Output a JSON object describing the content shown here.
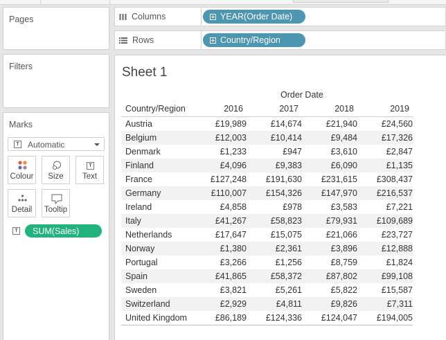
{
  "panels": {
    "pages_title": "Pages",
    "filters_title": "Filters",
    "marks_title": "Marks"
  },
  "shelves": {
    "columns_label": "Columns",
    "columns_pill": "YEAR(Order Date)",
    "rows_label": "Rows",
    "rows_pill": "Country/Region"
  },
  "marks": {
    "mark_type": "Automatic",
    "buttons": {
      "colour": "Colour",
      "size": "Size",
      "text": "Text",
      "detail": "Detail",
      "tooltip": "Tooltip"
    },
    "text_field_pill": "SUM(Sales)",
    "colors": {
      "red": "#e4584f",
      "orange": "#f28e2b",
      "blue": "#4e79a7",
      "purple": "#b07aa1",
      "pill_green": "#20b37d",
      "pill_blue": "#4d96b1"
    }
  },
  "sheet": {
    "title": "Sheet 1",
    "column_group_header": "Order Date",
    "row_header": "Country/Region",
    "years": [
      "2016",
      "2017",
      "2018",
      "2019"
    ],
    "rows": [
      {
        "country": "Austria",
        "values": [
          "£19,989",
          "£14,674",
          "£21,940",
          "£24,560"
        ]
      },
      {
        "country": "Belgium",
        "values": [
          "£12,003",
          "£10,414",
          "£9,484",
          "£17,326"
        ]
      },
      {
        "country": "Denmark",
        "values": [
          "£1,233",
          "£947",
          "£3,610",
          "£2,847"
        ]
      },
      {
        "country": "Finland",
        "values": [
          "£4,096",
          "£9,383",
          "£6,090",
          "£1,135"
        ]
      },
      {
        "country": "France",
        "values": [
          "£127,248",
          "£191,630",
          "£231,615",
          "£308,437"
        ]
      },
      {
        "country": "Germany",
        "values": [
          "£110,007",
          "£154,326",
          "£147,970",
          "£216,537"
        ]
      },
      {
        "country": "Ireland",
        "values": [
          "£4,858",
          "£978",
          "£3,583",
          "£7,221"
        ]
      },
      {
        "country": "Italy",
        "values": [
          "£41,267",
          "£58,823",
          "£79,931",
          "£109,689"
        ]
      },
      {
        "country": "Netherlands",
        "values": [
          "£17,647",
          "£15,075",
          "£21,066",
          "£23,727"
        ]
      },
      {
        "country": "Norway",
        "values": [
          "£1,380",
          "£2,361",
          "£3,896",
          "£12,888"
        ]
      },
      {
        "country": "Portugal",
        "values": [
          "£3,266",
          "£1,256",
          "£8,759",
          "£1,824"
        ]
      },
      {
        "country": "Spain",
        "values": [
          "£41,865",
          "£58,372",
          "£87,802",
          "£99,108"
        ]
      },
      {
        "country": "Sweden",
        "values": [
          "£3,821",
          "£5,261",
          "£5,822",
          "£15,587"
        ]
      },
      {
        "country": "Switzerland",
        "values": [
          "£2,929",
          "£4,811",
          "£9,826",
          "£7,311"
        ]
      },
      {
        "country": "United Kingdom",
        "values": [
          "£86,189",
          "£124,336",
          "£124,047",
          "£194,005"
        ]
      }
    ]
  }
}
